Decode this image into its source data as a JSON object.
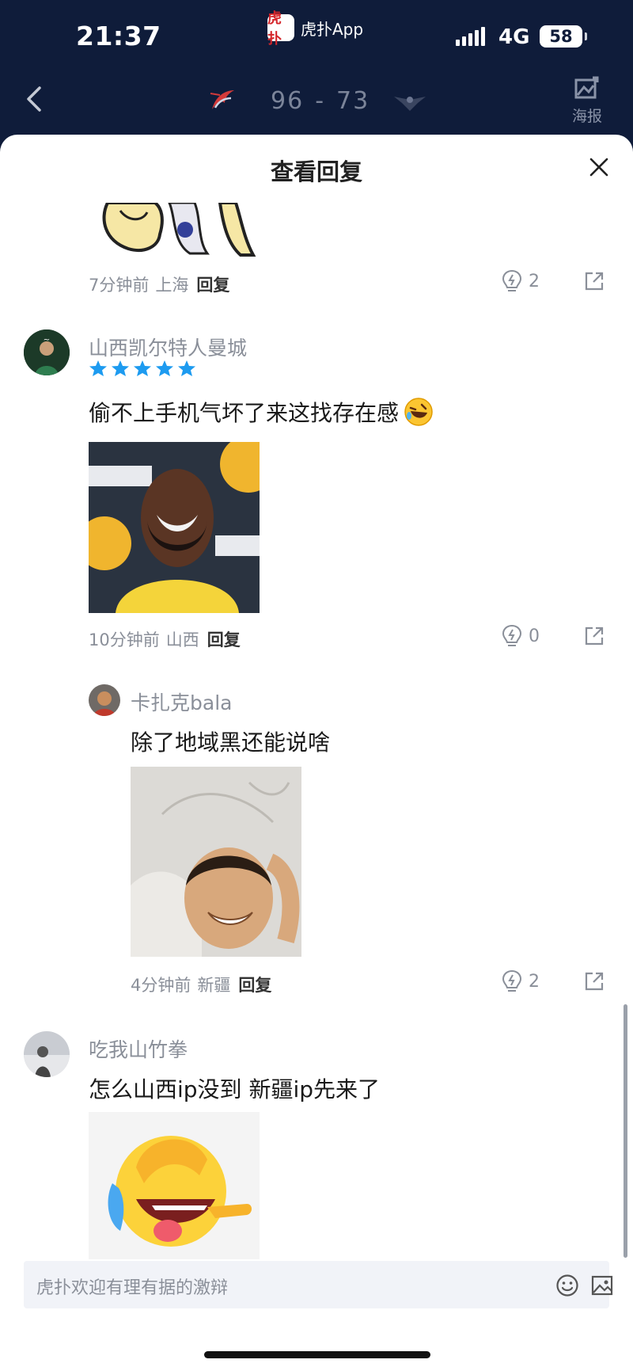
{
  "status_bar": {
    "time": "21:37",
    "network": "4G",
    "battery": "58",
    "app_logo": "虎扑",
    "app_name": "虎扑App"
  },
  "match_header": {
    "score_home": "96",
    "score_separator": "-",
    "score_away": "73",
    "poster_label": "海报",
    "home_team_icon": "sharks-logo",
    "away_team_icon": "flying-tigers-logo"
  },
  "sheet": {
    "title": "查看回复"
  },
  "comments": [
    {
      "time": "7分钟前",
      "location": "上海",
      "reply": "回复",
      "likes": "2"
    },
    {
      "username": "山西凯尔特人曼城",
      "stars": 5,
      "text": "偷不上手机气坏了来这找存在感",
      "emoji": "rolling-laugh-emoji",
      "time": "10分钟前",
      "location": "山西",
      "reply": "回复",
      "likes": "0"
    },
    {
      "username": "卡扎克bala",
      "text": "除了地域黑还能说啥",
      "time": "4分钟前",
      "location": "新疆",
      "reply": "回复",
      "likes": "2"
    },
    {
      "username": "吃我山竹拳",
      "text": "怎么山西ip没到 新疆ip先来了"
    }
  ],
  "input": {
    "placeholder": "虎扑欢迎有理有据的激辩"
  },
  "colors": {
    "header_bg": "#0f1c3a",
    "star_blue": "#1d9bf0",
    "text_gray": "#8a8f99"
  }
}
